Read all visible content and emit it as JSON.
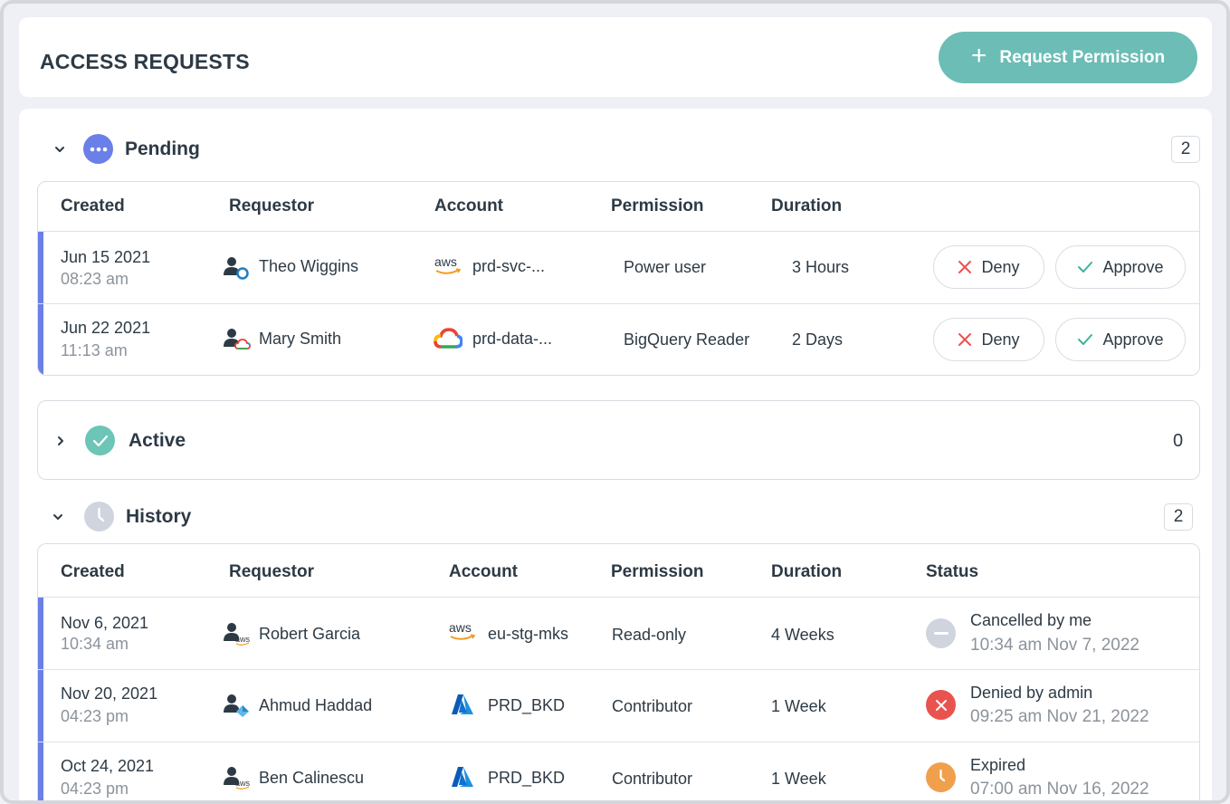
{
  "header": {
    "title": "ACCESS REQUESTS",
    "request_button": "Request Permission"
  },
  "pending": {
    "title": "Pending",
    "count": "2",
    "columns": [
      "Created",
      "Requestor",
      "Account",
      "Permission",
      "Duration"
    ],
    "rows": [
      {
        "date": "Jun 15 2021",
        "time": "08:23 am",
        "requestor": "Theo Wiggins",
        "provider": "aws",
        "account": "prd-svc-...",
        "permission": "Power user",
        "duration": "3 Hours"
      },
      {
        "date": "Jun 22 2021",
        "time": "11:13 am",
        "requestor": "Mary Smith",
        "provider": "gcp",
        "account": "prd-data-...",
        "permission": "BigQuery Reader",
        "duration": "2 Days"
      }
    ],
    "deny_label": "Deny",
    "approve_label": "Approve"
  },
  "active": {
    "title": "Active",
    "count": "0"
  },
  "history": {
    "title": "History",
    "count": "2",
    "columns": [
      "Created",
      "Requestor",
      "Account",
      "Permission",
      "Duration",
      "Status"
    ],
    "rows": [
      {
        "date": "Nov 6, 2021",
        "time": "10:34 am",
        "requestor": "Robert Garcia",
        "provider": "aws",
        "account": "eu-stg-mks",
        "permission": "Read-only",
        "duration": "4 Weeks",
        "status": "Cancelled by me",
        "status_time": "10:34 am Nov 7, 2022",
        "status_kind": "cancelled"
      },
      {
        "date": "Nov 20, 2021",
        "time": "04:23 pm",
        "requestor": "Ahmud Haddad",
        "provider": "azure",
        "account": "PRD_BKD",
        "permission": "Contributor",
        "duration": "1 Week",
        "status": "Denied by admin",
        "status_time": "09:25 am Nov 21, 2022",
        "status_kind": "denied"
      },
      {
        "date": "Oct 24, 2021",
        "time": "04:23 pm",
        "requestor": "Ben Calinescu",
        "provider": "azure",
        "account": "PRD_BKD",
        "permission": "Contributor",
        "duration": "1 Week",
        "status": "Expired",
        "status_time": "07:00 am Nov 16, 2022",
        "status_kind": "expired"
      }
    ]
  },
  "colors": {
    "accent": "#6bbdb5",
    "pending_icon": "#6a7fe8",
    "row_bar": "#6a7fe8",
    "active_icon": "#6cc5b6",
    "history_icon": "#cfd4de",
    "denied": "#e9534f",
    "expired": "#f0a04b",
    "cancelled": "#cfd4de"
  },
  "icons": {
    "pending": "more-dots-icon",
    "active": "check-circle-icon",
    "history": "clock-icon",
    "deny": "close-icon",
    "approve": "check-icon"
  }
}
